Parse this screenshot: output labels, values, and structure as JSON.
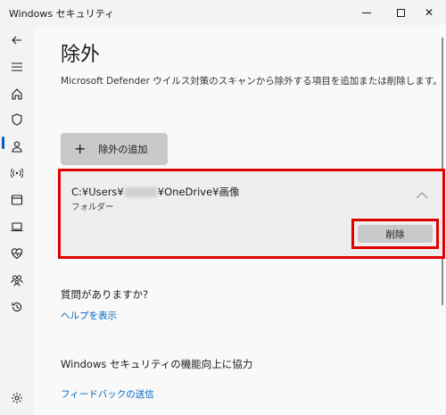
{
  "window": {
    "title": "Windows セキュリティ",
    "minimize_icon": "minimize-icon",
    "maximize_icon": "maximize-icon",
    "close_icon": "close-icon",
    "close_glyph": "✕"
  },
  "sidebar": {
    "items": [
      {
        "name": "back-arrow-icon"
      },
      {
        "name": "hamburger-menu-icon"
      },
      {
        "name": "home-icon"
      },
      {
        "name": "shield-icon",
        "active": true
      },
      {
        "name": "account-icon"
      },
      {
        "name": "network-icon"
      },
      {
        "name": "app-browser-icon"
      },
      {
        "name": "device-security-icon"
      },
      {
        "name": "health-icon"
      },
      {
        "name": "family-icon"
      },
      {
        "name": "history-icon"
      },
      {
        "name": "settings-gear-icon"
      }
    ],
    "accent": "#005fb8"
  },
  "main": {
    "title": "除外",
    "description": "Microsoft Defender ウイルス対策のスキャンから除外する項目を追加または削除します。",
    "add_button": {
      "plus": "+",
      "label": "除外の追加"
    },
    "exclusion": {
      "path_prefix": "C:¥Users¥",
      "path_suffix": "¥OneDrive¥画像",
      "type": "フォルダー",
      "remove_label": "削除"
    },
    "help": {
      "heading": "質問がありますか?",
      "link": "ヘルプを表示"
    },
    "feedback": {
      "heading": "Windows セキュリティの機能向上に協力",
      "link": "フィードバックの送信"
    }
  },
  "colors": {
    "highlight": "#e00000",
    "link": "#0067c0"
  }
}
